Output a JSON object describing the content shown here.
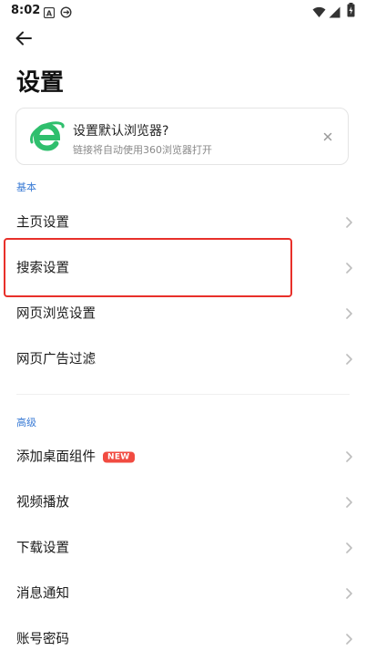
{
  "status_bar": {
    "time": "8:02",
    "left_icons": [
      "a-box-icon",
      "sync-icon"
    ],
    "right_icons": [
      "wifi-icon",
      "signal-icon",
      "battery-charging-icon"
    ]
  },
  "header": {
    "back_icon": "arrow-left-icon",
    "title": "设置"
  },
  "promo": {
    "logo": "360-browser-logo",
    "title": "设置默认浏览器?",
    "subtitle": "链接将自动使用360浏览器打开",
    "close_icon": "close-icon"
  },
  "sections": [
    {
      "header": "基本",
      "items": [
        {
          "label": "主页设置"
        },
        {
          "label": "搜索设置",
          "highlighted": true
        },
        {
          "label": "网页浏览设置"
        },
        {
          "label": "网页广告过滤"
        }
      ]
    },
    {
      "header": "高级",
      "items": [
        {
          "label": "添加桌面组件",
          "badge": "NEW"
        },
        {
          "label": "视频播放"
        },
        {
          "label": "下载设置"
        },
        {
          "label": "消息通知"
        },
        {
          "label": "账号密码"
        }
      ]
    }
  ],
  "colors": {
    "accent": "#3a7bd5",
    "badge": "#f14b41",
    "highlight": "#e8302a",
    "logo_green": "#2fbf6d"
  }
}
